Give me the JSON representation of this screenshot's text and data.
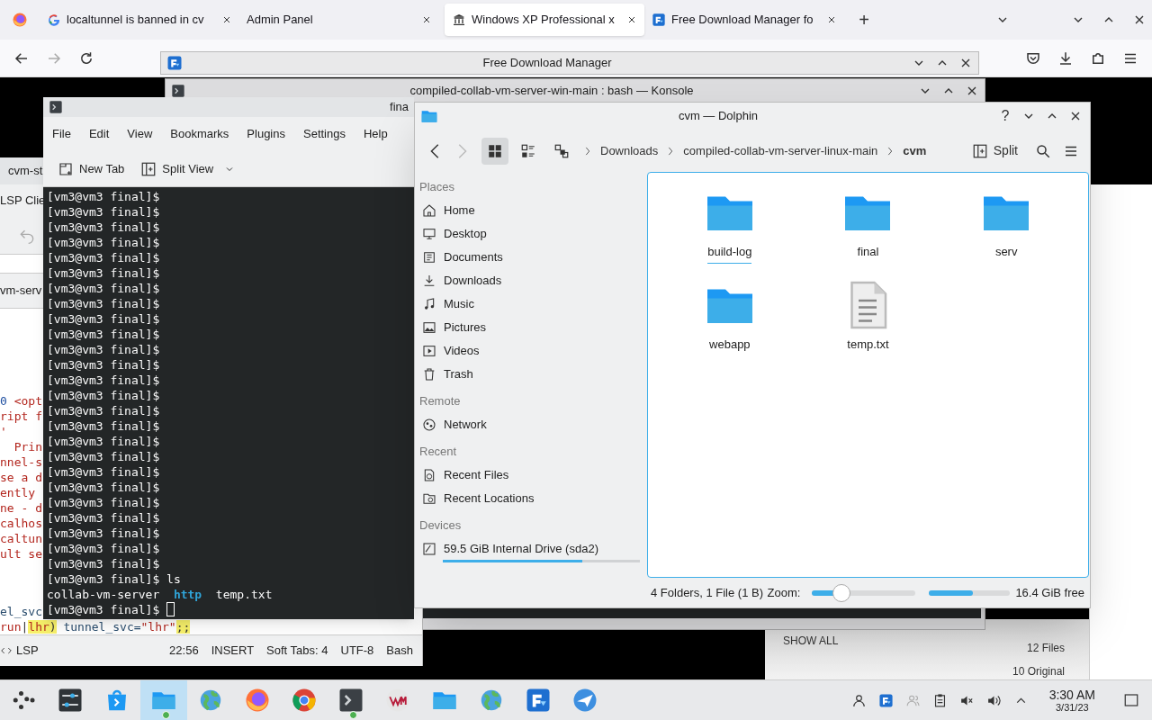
{
  "browser": {
    "tabs": [
      {
        "title": "localtunnel is banned in cv",
        "kind": "google",
        "selected": false
      },
      {
        "title": "Admin Panel",
        "selected": false
      },
      {
        "title": "Windows XP Professional x",
        "kind": "archive",
        "selected": true
      },
      {
        "title": "Free Download Manager fo",
        "kind": "fdm",
        "selected": false
      }
    ],
    "new_tab": "+",
    "page": {
      "show_all": "SHOW ALL",
      "files": "12 Files",
      "original": "10 Original"
    }
  },
  "fdm_window": {
    "title": "Free Download Manager"
  },
  "konsole_back": {
    "title": "compiled-collab-vm-server-win-main : bash — Konsole"
  },
  "editor": {
    "tab": "cvm-st",
    "panel": "LSP Clie",
    "doc_tab": "vm-serv",
    "code": [
      [
        {
          "text": "0",
          "kind": "number"
        },
        {
          "text": " <opt",
          "kind": "string"
        }
      ],
      [
        {
          "text": "ript f",
          "kind": "string"
        }
      ],
      [
        {
          "text": "'",
          "kind": "string"
        }
      ],
      [
        {
          "text": "  Prin",
          "kind": "string"
        }
      ],
      [
        {
          "text": "nnel-s",
          "kind": "string"
        }
      ],
      [
        {
          "text": "se a d",
          "kind": "string"
        }
      ],
      [
        {
          "text": "ently",
          "kind": "string"
        }
      ],
      [
        {
          "text": "ne - d",
          "kind": "string"
        }
      ],
      [
        {
          "text": "calhos",
          "kind": "string"
        }
      ],
      [
        {
          "text": "caltun",
          "kind": "string"
        }
      ],
      [
        {
          "text": "ult se",
          "kind": "string"
        }
      ]
    ],
    "code_end": [
      [
        {
          "text": "el_svc",
          "kind": "variable"
        }
      ],
      [
        {
          "text": "run",
          "kind": "string"
        },
        {
          "text": "|",
          "kind": "operator"
        },
        {
          "text": "lhr",
          "kind": "string",
          "highlight": true
        },
        {
          "text": ")",
          "kind": "operator",
          "highlight": true
        },
        {
          "text": " tunnel_svc=",
          "kind": "variable"
        },
        {
          "text": "\"lhr\"",
          "kind": "string"
        },
        {
          "text": ";;",
          "kind": "operator",
          "highlight": true
        }
      ]
    ],
    "status": [
      "LSP",
      "22:56",
      "INSERT",
      "Soft Tabs: 4",
      "UTF-8",
      "Bash"
    ]
  },
  "konsole": {
    "title": "fina",
    "menu": [
      "File",
      "Edit",
      "View",
      "Bookmarks",
      "Plugins",
      "Settings",
      "Help"
    ],
    "toolbar": [
      {
        "label": "New Tab",
        "kind": "new-tab"
      },
      {
        "label": "Split View",
        "kind": "split"
      }
    ],
    "lines": [
      "[vm3@vm3 final]$",
      "[vm3@vm3 final]$",
      "[vm3@vm3 final]$",
      "[vm3@vm3 final]$",
      "[vm3@vm3 final]$",
      "[vm3@vm3 final]$",
      "[vm3@vm3 final]$",
      "[vm3@vm3 final]$",
      "[vm3@vm3 final]$",
      "[vm3@vm3 final]$",
      "[vm3@vm3 final]$",
      "[vm3@vm3 final]$",
      "[vm3@vm3 final]$",
      "[vm3@vm3 final]$",
      "[vm3@vm3 final]$",
      "[vm3@vm3 final]$",
      "[vm3@vm3 final]$",
      "[vm3@vm3 final]$",
      "[vm3@vm3 final]$",
      "[vm3@vm3 final]$",
      "[vm3@vm3 final]$",
      "[vm3@vm3 final]$",
      "[vm3@vm3 final]$",
      "[vm3@vm3 final]$",
      "[vm3@vm3 final]$",
      "[vm3@vm3 final]$ ls"
    ],
    "ls_output": [
      {
        "name": "collab-vm-server",
        "kind": "file"
      },
      {
        "name": "http",
        "kind": "dir"
      },
      {
        "name": "temp.txt",
        "kind": "file"
      }
    ],
    "prompt": "[vm3@vm3 final]$"
  },
  "dolphin": {
    "title": "cvm — Dolphin",
    "help": "?",
    "view_modes": [
      {
        "kind": "icons",
        "selected": true
      },
      {
        "kind": "details",
        "selected": false
      },
      {
        "kind": "tree",
        "selected": false
      }
    ],
    "breadcrumbs": [
      {
        "label": "Downloads",
        "current": false
      },
      {
        "label": "compiled-collab-vm-server-linux-main",
        "current": false
      },
      {
        "label": "cvm",
        "current": true
      }
    ],
    "split": "Split",
    "places": [
      {
        "heading": "Places",
        "items": [
          {
            "label": "Home",
            "kind": "home"
          },
          {
            "label": "Desktop",
            "kind": "desktop"
          },
          {
            "label": "Documents",
            "kind": "documents"
          },
          {
            "label": "Downloads",
            "kind": "downloads"
          },
          {
            "label": "Music",
            "kind": "music"
          },
          {
            "label": "Pictures",
            "kind": "pictures"
          },
          {
            "label": "Videos",
            "kind": "videos"
          },
          {
            "label": "Trash",
            "kind": "trash"
          }
        ]
      },
      {
        "heading": "Remote",
        "items": [
          {
            "label": "Network",
            "kind": "network"
          }
        ]
      },
      {
        "heading": "Recent",
        "items": [
          {
            "label": "Recent Files",
            "kind": "recent-files"
          },
          {
            "label": "Recent Locations",
            "kind": "recent-locations"
          }
        ]
      },
      {
        "heading": "Devices",
        "items": [
          {
            "label": "59.5 GiB Internal Drive (sda2)",
            "kind": "drive",
            "level": 0.71
          }
        ]
      }
    ],
    "files": [
      {
        "name": "build-log",
        "kind": "folder",
        "current": true
      },
      {
        "name": "final",
        "kind": "folder",
        "current": false
      },
      {
        "name": "serv",
        "kind": "folder",
        "current": false
      },
      {
        "name": "webapp",
        "kind": "folder",
        "current": false
      },
      {
        "name": "temp.txt",
        "kind": "text",
        "current": false
      }
    ],
    "status": "4 Folders, 1 File (1 B)",
    "zoom_label": "Zoom:",
    "zoom": {
      "level": 0.28
    },
    "free": {
      "level": 0.54
    },
    "free_text": "16.4 GiB free"
  },
  "taskbar": {
    "apps": [
      {
        "kind": "launcher",
        "active": false,
        "badge": false
      },
      {
        "kind": "mixer",
        "active": false,
        "badge": false
      },
      {
        "kind": "store",
        "active": false,
        "badge": false
      },
      {
        "kind": "folder",
        "active": true,
        "badge": true
      },
      {
        "kind": "globe",
        "active": false,
        "badge": false
      },
      {
        "kind": "firefox",
        "active": false,
        "badge": false
      },
      {
        "kind": "chrome",
        "active": false,
        "badge": false
      },
      {
        "kind": "terminal",
        "active": false,
        "badge": true
      },
      {
        "kind": "vm",
        "active": false,
        "badge": false
      },
      {
        "kind": "folder",
        "active": false,
        "badge": false
      },
      {
        "kind": "globe",
        "active": false,
        "badge": false
      },
      {
        "kind": "fdm",
        "active": false,
        "badge": false
      },
      {
        "kind": "plane",
        "active": false,
        "badge": false
      }
    ],
    "tray": [
      {
        "kind": "user"
      },
      {
        "kind": "fdm"
      },
      {
        "kind": "users"
      },
      {
        "kind": "clipboard"
      },
      {
        "kind": "muted"
      },
      {
        "kind": "volume"
      },
      {
        "kind": "caret-up"
      }
    ],
    "time": "3:30 AM",
    "date": "3/31/23"
  }
}
